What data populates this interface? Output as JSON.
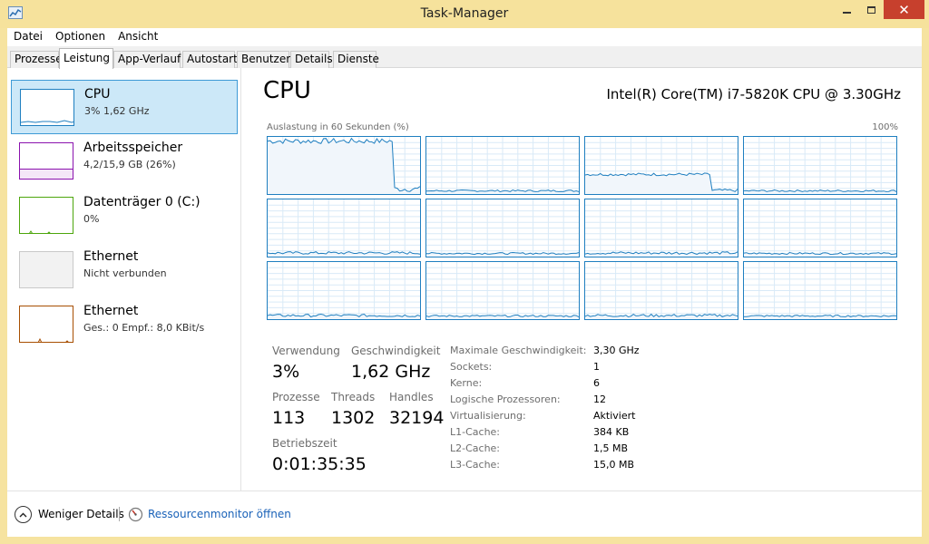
{
  "window": {
    "title": "Task-Manager",
    "close_glyph": "✕"
  },
  "menu": [
    "Datei",
    "Optionen",
    "Ansicht"
  ],
  "tabs": [
    "Prozesse",
    "Leistung",
    "App-Verlauf",
    "Autostart",
    "Benutzer",
    "Details",
    "Dienste"
  ],
  "active_tab": "Leistung",
  "sidebar": {
    "items": [
      {
        "title": "CPU",
        "subtitle": "3% 1,62 GHz",
        "color": "#1f7fc0",
        "icon": "cpu-graph-thumbnail"
      },
      {
        "title": "Arbeitsspeicher",
        "subtitle": "4,2/15,9 GB (26%)",
        "color": "#8b12ae",
        "icon": "memory-graph-thumbnail"
      },
      {
        "title": "Datenträger 0 (C:)",
        "subtitle": "0%",
        "color": "#4da60c",
        "icon": "disk-graph-thumbnail"
      },
      {
        "title": "Ethernet",
        "subtitle": "Nicht verbunden",
        "color": "#999999",
        "icon": "ethernet-graph-thumbnail"
      },
      {
        "title": "Ethernet",
        "subtitle": "Ges.: 0 Empf.: 8,0 KBit/s",
        "color": "#a74f01",
        "icon": "ethernet-graph-thumbnail"
      }
    ]
  },
  "main": {
    "title": "CPU",
    "cpu_name": "Intel(R) Core(TM) i7-5820K CPU @ 3.30GHz",
    "graph_label": "Auslastung in 60 Sekunden (%)",
    "graph_max": "100%",
    "core_count": 12,
    "stats": {
      "usage_label": "Verwendung",
      "usage_value": "3%",
      "speed_label": "Geschwindigkeit",
      "speed_value": "1,62 GHz",
      "processes_label": "Prozesse",
      "processes_value": "113",
      "threads_label": "Threads",
      "threads_value": "1302",
      "handles_label": "Handles",
      "handles_value": "32194",
      "uptime_label": "Betriebszeit",
      "uptime_value": "0:01:35:35"
    },
    "specs": [
      {
        "label": "Maximale Geschwindigkeit:",
        "value": "3,30 GHz"
      },
      {
        "label": "Sockets:",
        "value": "1"
      },
      {
        "label": "Kerne:",
        "value": "6"
      },
      {
        "label": "Logische Prozessoren:",
        "value": "12"
      },
      {
        "label": "Virtualisierung:",
        "value": "Aktiviert"
      },
      {
        "label": "L1-Cache:",
        "value": "384 KB"
      },
      {
        "label": "L2-Cache:",
        "value": "1,5 MB"
      },
      {
        "label": "L3-Cache:",
        "value": "15,0 MB"
      }
    ]
  },
  "footer": {
    "fewer_details": "Weniger Details",
    "resource_monitor": "Ressourcenmonitor öffnen"
  },
  "colors": {
    "accent": "#1f7fc0",
    "selection_bg": "#cce8f8",
    "link": "#1a62b8",
    "title_bar": "#f6e29c",
    "close": "#c7402d"
  }
}
